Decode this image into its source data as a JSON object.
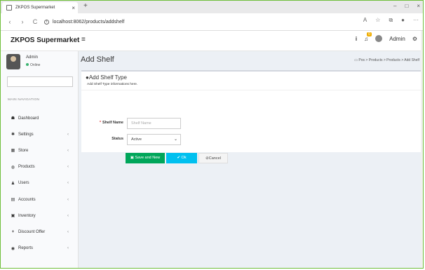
{
  "browser": {
    "tab_title": "ZKPOS Supermarket",
    "tab_close": "×",
    "new_tab": "+",
    "url": "localhost:8062/products/addshelf",
    "back": "‹",
    "forward": "›",
    "reload": "C",
    "info": "i",
    "minimize": "–",
    "maximize": "□",
    "close": "×",
    "read_aloud": "A",
    "favorites": "☆",
    "collections": "⧉",
    "more": "···"
  },
  "header": {
    "brand": "ZKPOS Supermarket",
    "menu_toggle": "≡",
    "info_icon": "i",
    "notification_count": "0",
    "user": "Admin",
    "settings_icon": "⚙"
  },
  "sidebar": {
    "user_name": "Admin",
    "user_status": "Online",
    "nav_header": "MAIN NAVIGATION",
    "items": [
      {
        "label": "Dashboard",
        "icon": "☗"
      },
      {
        "label": "Settings",
        "icon": "✱"
      },
      {
        "label": "Store",
        "icon": "▦"
      },
      {
        "label": "Products",
        "icon": "◍"
      },
      {
        "label": "Users",
        "icon": "♟"
      },
      {
        "label": "Accounts",
        "icon": "▤"
      },
      {
        "label": "Inventory",
        "icon": "▣"
      },
      {
        "label": "Discount Offer",
        "icon": "+"
      },
      {
        "label": "Reports",
        "icon": "◉"
      }
    ],
    "chevron": "‹"
  },
  "page": {
    "title": "Add Shelf",
    "breadcrumb": "Pos > Products > Products > Add Shelf"
  },
  "form": {
    "box_title": "Add Shelf Type",
    "box_subtitle": "Add Shelf Type informations here.",
    "shelf_name_label": "Shelf Name",
    "required_mark": "*",
    "shelf_name_placeholder": "Shelf Name",
    "status_label": "Status",
    "status_value": "Active",
    "dropdown_arrow": "⌄",
    "save_new_label": "Save and New",
    "ok_label": "Ok",
    "cancel_label": "Cancel"
  },
  "colors": {
    "save": "#00a65a",
    "ok": "#00c0ef",
    "online": "#3cb371",
    "badge": "#f0ad00"
  }
}
